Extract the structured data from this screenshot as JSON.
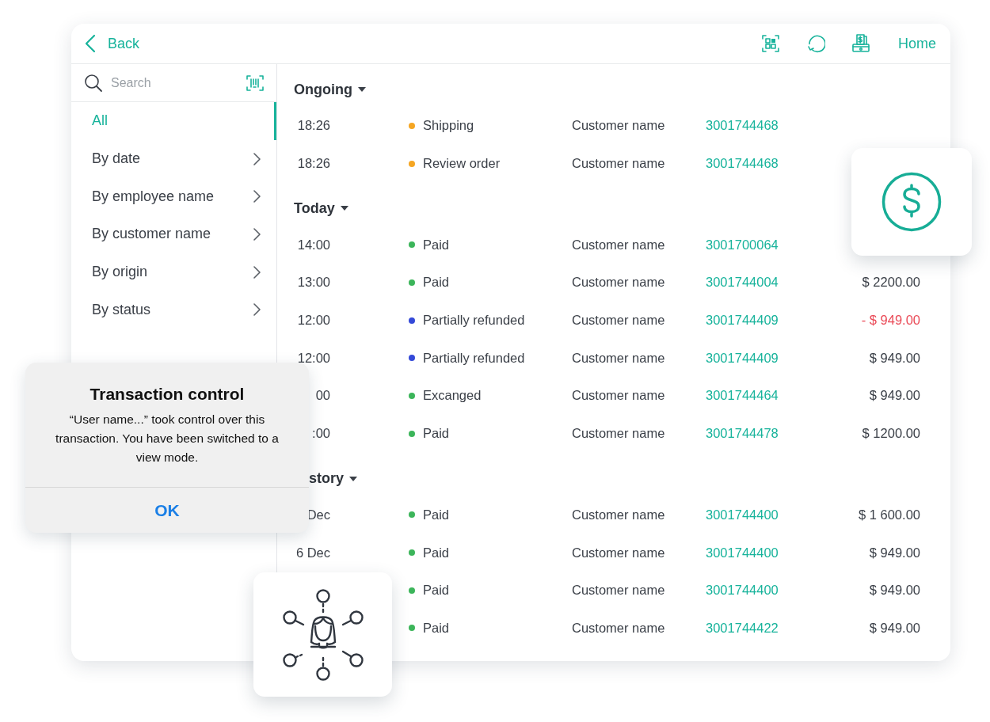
{
  "header": {
    "back_label": "Back",
    "home_label": "Home"
  },
  "sidebar": {
    "search": {
      "placeholder": "Search"
    },
    "items": [
      {
        "label": "All",
        "selected": true,
        "has_submenu": false
      },
      {
        "label": "By date",
        "selected": false,
        "has_submenu": true
      },
      {
        "label": "By employee name",
        "selected": false,
        "has_submenu": true
      },
      {
        "label": "By customer name",
        "selected": false,
        "has_submenu": true
      },
      {
        "label": "By origin",
        "selected": false,
        "has_submenu": true
      },
      {
        "label": "By status",
        "selected": false,
        "has_submenu": true
      }
    ]
  },
  "sections": [
    {
      "title": "Ongoing",
      "expanded": true,
      "rows": [
        {
          "time": "18:26",
          "status": "Shipping",
          "color": "#f5a623",
          "customer": "Customer name",
          "number": "3001744468"
        },
        {
          "time": "18:26",
          "status": "Review order",
          "color": "#f5a623",
          "customer": "Customer name",
          "number": "3001744468"
        }
      ]
    },
    {
      "title": "Today",
      "expanded": true,
      "rows": [
        {
          "time": "14:00",
          "status": "Paid",
          "color": "#3cb55a",
          "customer": "Customer name",
          "number": "3001700064"
        },
        {
          "time": "13:00",
          "status": "Paid",
          "color": "#3cb55a",
          "customer": "Customer name",
          "number": "3001744004",
          "amount": "$ 2200.00",
          "refund": false
        },
        {
          "time": "12:00",
          "status": "Partially refunded",
          "color": "#3449d8",
          "customer": "Customer name",
          "number": "3001744409",
          "amount": "- $ 949.00",
          "refund": true
        },
        {
          "time": "12:00",
          "status": "Partially refunded",
          "color": "#3449d8",
          "customer": "Customer name",
          "number": "3001744409",
          "amount": "$ 949.00",
          "refund": false
        },
        {
          "time": "00",
          "status": "Excanged",
          "color": "#3cb55a",
          "customer": "Customer name",
          "number": "3001744464",
          "amount": "$ 949.00",
          "refund": false
        },
        {
          "time": ":00",
          "status": "Paid",
          "color": "#3cb55a",
          "customer": "Customer name",
          "number": "3001744478",
          "amount": "$ 1200.00",
          "refund": false
        }
      ]
    },
    {
      "title": "story",
      "title_cut": true,
      "expanded": true,
      "rows": [
        {
          "time": "Dec",
          "status": "Paid",
          "color": "#3cb55a",
          "customer": "Customer name",
          "number": "3001744400",
          "amount": "$ 1 600.00",
          "refund": false
        },
        {
          "time": "6 Dec",
          "status": "Paid",
          "color": "#3cb55a",
          "customer": "Customer name",
          "number": "3001744400",
          "amount": "$ 949.00",
          "refund": false
        },
        {
          "status": "Paid",
          "color": "#3cb55a",
          "customer": "Customer name",
          "number": "3001744400",
          "amount": "$ 949.00",
          "refund": false
        },
        {
          "status": "Paid",
          "color": "#3cb55a",
          "customer": "Customer name",
          "number": "3001744422",
          "amount": "$ 949.00",
          "refund": false
        }
      ]
    }
  ],
  "dialog": {
    "title": "Transaction control",
    "message": "“User name...” took control over this transaction. You have been switched to a view mode.",
    "button": "OK"
  }
}
